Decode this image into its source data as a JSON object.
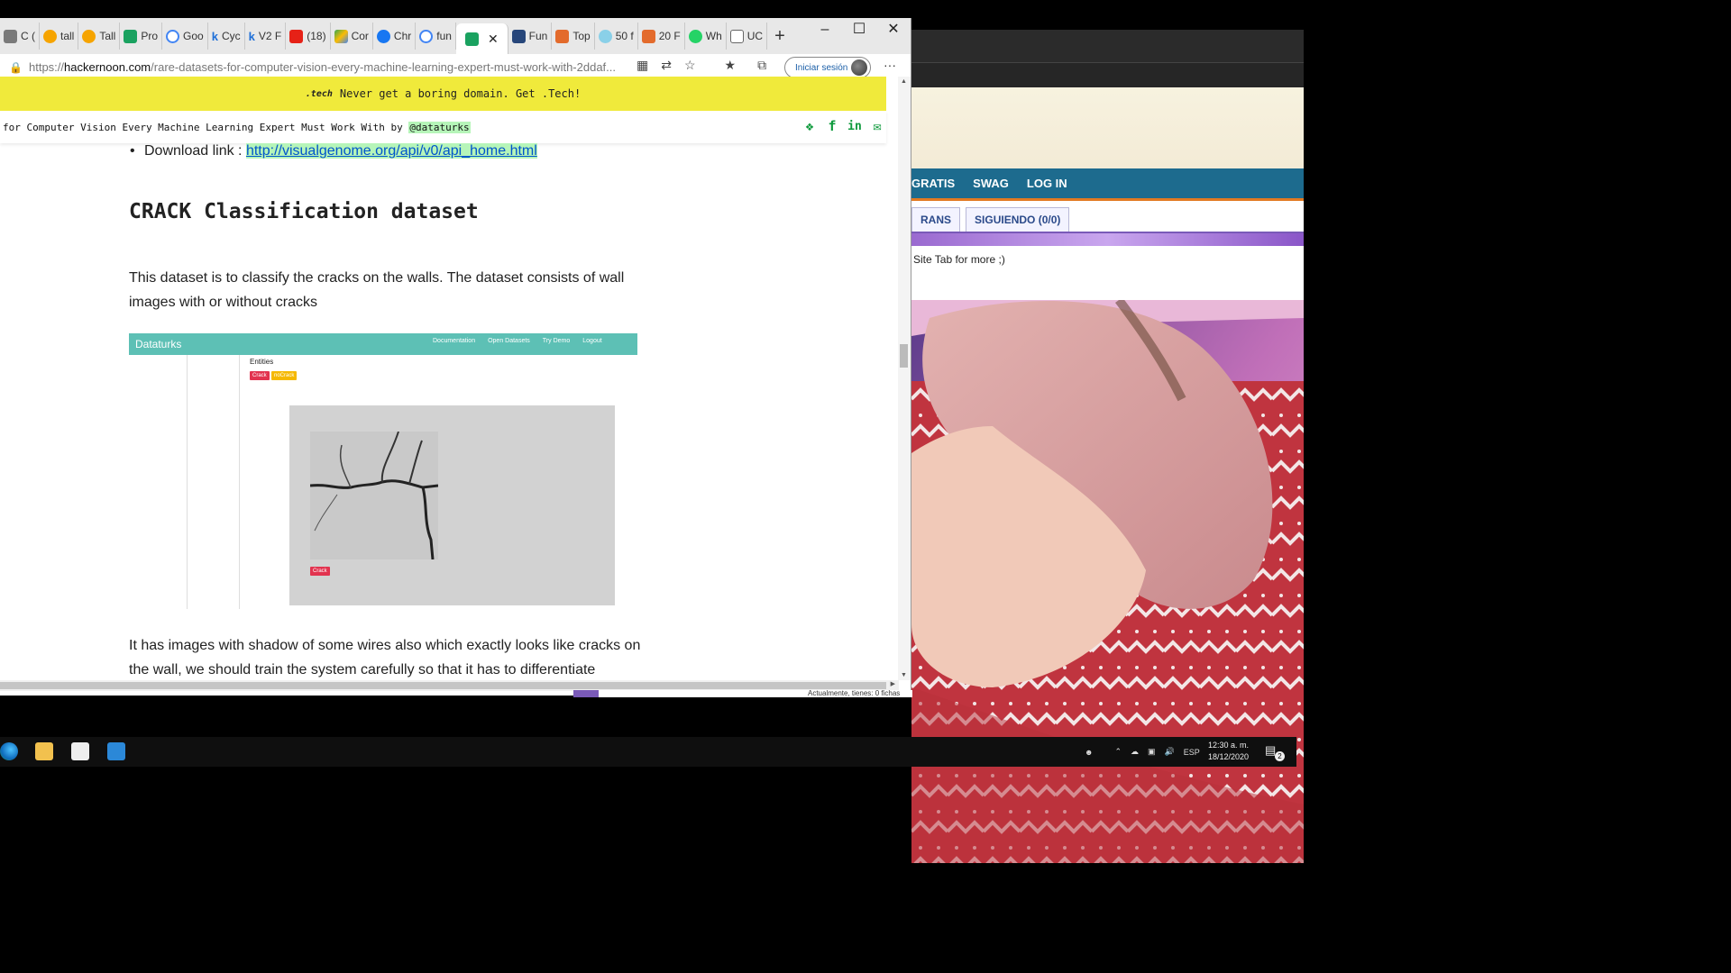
{
  "browser": {
    "tabs": [
      {
        "label": "C (",
        "color": "#7a7a7a"
      },
      {
        "label": "tall",
        "color": "#f6a400"
      },
      {
        "label": "Tall",
        "color": "#f6a400"
      },
      {
        "label": "Pro",
        "color": "#1aa260"
      },
      {
        "label": "Goo",
        "color": "#4285f4"
      },
      {
        "label": "Cyc",
        "color": "#1e6fd8"
      },
      {
        "label": "V2 F",
        "color": "#1e6fd8"
      },
      {
        "label": "(18)",
        "color": "#e62117"
      },
      {
        "label": "Cor",
        "color": "#34a853"
      },
      {
        "label": "Chr",
        "color": "#1877f2"
      },
      {
        "label": "fun",
        "color": "#4285f4"
      }
    ],
    "active_tab": {
      "label": "",
      "close": "✕"
    },
    "tabs_after": [
      {
        "label": "Fun",
        "color": "#27467a"
      },
      {
        "label": "Top",
        "color": "#e36b2c"
      },
      {
        "label": "50 f",
        "color": "#8ad0e8"
      },
      {
        "label": "20 F",
        "color": "#e36b2c"
      },
      {
        "label": "Wh",
        "color": "#25d366"
      },
      {
        "label": "UC",
        "color": "#666666"
      }
    ],
    "new_tab": "+",
    "window_controls": {
      "minimize": "–",
      "maximize": "☐",
      "close": "✕"
    },
    "address": {
      "prefix": "https://",
      "host": "hackernoon.com",
      "path": "/rare-datasets-for-computer-vision-every-machine-learning-expert-must-work-with-2ddaf..."
    },
    "signin_label": "Iniciar sesión",
    "more": "···"
  },
  "promo": {
    "tech_logo": ".tech",
    "text": "Never get a boring domain. Get .Tech!"
  },
  "title_bar": {
    "text": "for Computer Vision Every Machine Learning Expert Must Work With by ",
    "handle": "@dataturks"
  },
  "article": {
    "download_label": "Download link : ",
    "download_link": "http://visualgenome.org/api/v0/api_home.html",
    "section_heading": "CRACK Classification dataset",
    "paragraph1": "This dataset is to classify the cracks on the walls. The dataset consists of wall images with or without cracks",
    "paragraph2": "It has images with shadow of some wires also which exactly looks like cracks on the wall, we should train the system carefully so that it has to differentiate"
  },
  "embedded_screenshot": {
    "brand": "Dataturks",
    "nav": [
      "Documentation",
      "Open Datasets",
      "Try Demo",
      "Logout"
    ],
    "entities_label": "Entities",
    "chips": [
      {
        "label": "Crack",
        "color": "#e2334f"
      },
      {
        "label": "noCrack",
        "color": "#f5b800"
      }
    ],
    "selected_label": "Crack"
  },
  "background_site": {
    "nav": [
      "GRATIS",
      "SWAG",
      "LOG IN"
    ],
    "tabs": [
      "RANS",
      "SIGUIENDO (0/0)"
    ],
    "note": "Site Tab for more ;)",
    "footer_text": "Actualmente, tienes: 0 fichas"
  },
  "taskbar": {
    "apps": [
      {
        "name": "edge",
        "color": "#1f8fd6"
      },
      {
        "name": "file-explorer",
        "color": "#f2c14e"
      },
      {
        "name": "store",
        "color": "#f2f2f2"
      },
      {
        "name": "mail",
        "color": "#2b88d8"
      }
    ],
    "language": "ESP",
    "time": "12:30 a. m.",
    "date": "18/12/2020",
    "notification_count": "2"
  }
}
